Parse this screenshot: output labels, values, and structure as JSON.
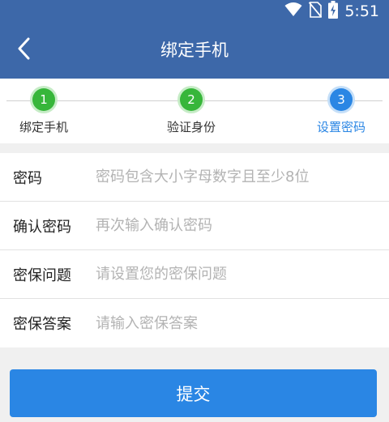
{
  "status_bar": {
    "time": "5:51",
    "icons": [
      "wifi-icon",
      "no-sim-icon",
      "battery-charging-icon"
    ]
  },
  "toolbar": {
    "back_icon": "chevron-left-icon",
    "title": "绑定手机"
  },
  "steps": [
    {
      "number": "1",
      "label": "绑定手机",
      "state": "done"
    },
    {
      "number": "2",
      "label": "验证身份",
      "state": "done"
    },
    {
      "number": "3",
      "label": "设置密码",
      "state": "active"
    }
  ],
  "form": {
    "rows": [
      {
        "label": "密码",
        "placeholder": "密码包含大小字母数字且至少8位",
        "value": ""
      },
      {
        "label": "确认密码",
        "placeholder": "再次输入确认密码",
        "value": ""
      },
      {
        "label": "密保问题",
        "placeholder": "请设置您的密保问题",
        "value": ""
      },
      {
        "label": "密保答案",
        "placeholder": "请输入密保答案",
        "value": ""
      }
    ]
  },
  "submit_label": "提交",
  "colors": {
    "app_bar": "#3d68a9",
    "accent": "#2a86e4",
    "step_done": "#37b63a"
  }
}
